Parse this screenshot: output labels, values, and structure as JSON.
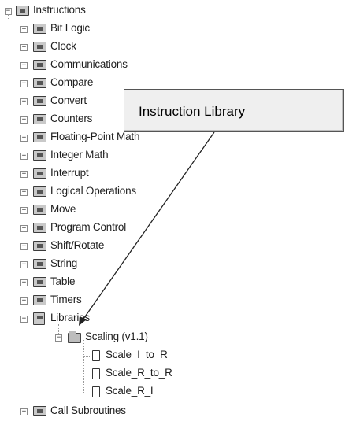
{
  "tree": {
    "root": {
      "label": "Instructions",
      "icon": "instructions-icon",
      "expander": "−"
    },
    "items": [
      {
        "label": "Bit Logic",
        "icon": "bit-logic-icon",
        "expander": "+"
      },
      {
        "label": "Clock",
        "icon": "clock-icon",
        "expander": "+"
      },
      {
        "label": "Communications",
        "icon": "communications-icon",
        "expander": "+"
      },
      {
        "label": "Compare",
        "icon": "compare-icon",
        "expander": "+"
      },
      {
        "label": "Convert",
        "icon": "convert-icon",
        "expander": "+"
      },
      {
        "label": "Counters",
        "icon": "counters-icon",
        "expander": "+"
      },
      {
        "label": "Floating-Point Math",
        "icon": "floating-point-math-icon",
        "expander": "+"
      },
      {
        "label": "Integer Math",
        "icon": "integer-math-icon",
        "expander": "+"
      },
      {
        "label": "Interrupt",
        "icon": "interrupt-icon",
        "expander": "+"
      },
      {
        "label": "Logical Operations",
        "icon": "logical-operations-icon",
        "expander": "+"
      },
      {
        "label": "Move",
        "icon": "move-icon",
        "expander": "+"
      },
      {
        "label": "Program Control",
        "icon": "program-control-icon",
        "expander": "+"
      },
      {
        "label": "Shift/Rotate",
        "icon": "shift-rotate-icon",
        "expander": "+"
      },
      {
        "label": "String",
        "icon": "string-icon",
        "expander": "+"
      },
      {
        "label": "Table",
        "icon": "table-icon",
        "expander": "+"
      },
      {
        "label": "Timers",
        "icon": "timers-icon",
        "expander": "+"
      },
      {
        "label": "Libraries",
        "icon": "libraries-icon",
        "expander": "−"
      }
    ],
    "library": {
      "label": "Scaling (v1.1)",
      "icon": "folder-icon",
      "expander": "−"
    },
    "library_items": [
      {
        "label": "Scale_I_to_R",
        "icon": "subroutine-icon"
      },
      {
        "label": "Scale_R_to_R",
        "icon": "subroutine-icon"
      },
      {
        "label": "Scale_R_I",
        "icon": "subroutine-icon"
      }
    ],
    "last": {
      "label": "Call Subroutines",
      "icon": "call-subroutines-icon",
      "expander": "+"
    }
  },
  "callout": {
    "label": "Instruction Library"
  }
}
